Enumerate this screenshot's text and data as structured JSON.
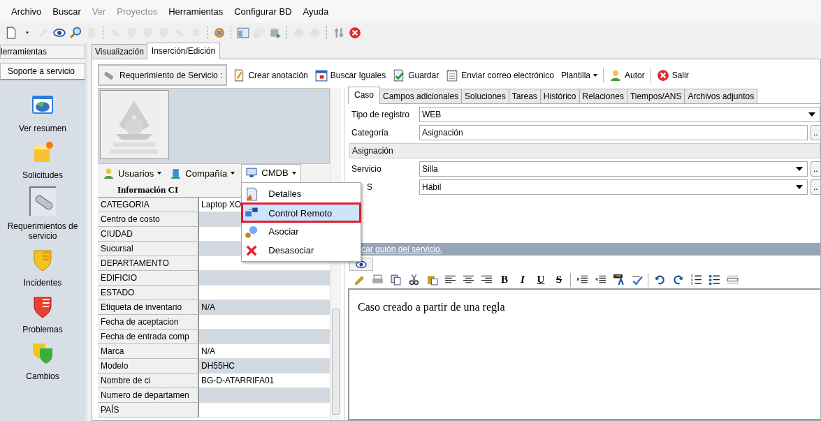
{
  "menu_bar": [
    {
      "label": "Archivo",
      "disabled": false
    },
    {
      "label": "Buscar",
      "disabled": false
    },
    {
      "label": "Ver",
      "disabled": true
    },
    {
      "label": "Proyectos",
      "disabled": true
    },
    {
      "label": "Herramientas",
      "disabled": false
    },
    {
      "label": "Configurar BD",
      "disabled": false
    },
    {
      "label": "Ayuda",
      "disabled": false
    }
  ],
  "toolbar": [
    {
      "disabled": false
    },
    {
      "disabled": false
    },
    {
      "disabled": true
    },
    {
      "disabled": false
    },
    {
      "disabled": false
    },
    {
      "disabled": true
    },
    {
      "disabled": true
    },
    {
      "disabled": true
    },
    {
      "disabled": true
    },
    {
      "disabled": true
    },
    {
      "disabled": true
    },
    {
      "disabled": true
    },
    {
      "disabled": false
    },
    {
      "disabled": false
    },
    {
      "disabled": true
    },
    {
      "disabled": false
    },
    {
      "disabled": true
    },
    {
      "disabled": true
    },
    {
      "disabled": false
    },
    {
      "disabled": false
    }
  ],
  "sidebar": {
    "tab": "lerramientas",
    "header": "Soporte a servicio",
    "items": [
      {
        "label": "Ver resumen",
        "selected": false
      },
      {
        "label": "Solicitudes",
        "selected": false
      },
      {
        "label": "Requerimientos de servicio",
        "selected": true
      },
      {
        "label": "Incidentes",
        "selected": false
      },
      {
        "label": "Problemas",
        "selected": false
      },
      {
        "label": "Cambios",
        "selected": false
      }
    ]
  },
  "main_tabs": [
    {
      "label": "Visualización",
      "selected": false
    },
    {
      "label": "Inserción/Edición",
      "selected": true
    }
  ],
  "action_bar": {
    "title": "Requerimiento de Servicio :",
    "buttons": [
      {
        "label": "Crear anotación",
        "dropdown": false
      },
      {
        "label": "Buscar Iguales",
        "dropdown": false
      },
      {
        "label": "Guardar",
        "dropdown": false
      },
      {
        "label": "Enviar correo electrónico",
        "dropdown": false
      },
      {
        "label": "Plantilla",
        "dropdown": true
      },
      {
        "label": "Autor",
        "dropdown": false
      },
      {
        "label": "Salir",
        "dropdown": false
      }
    ]
  },
  "ci_toolbar": [
    {
      "label": "Usuarios",
      "open": false
    },
    {
      "label": "Compañía",
      "open": false
    },
    {
      "label": "CMDB",
      "open": true
    }
  ],
  "cmdb_menu": [
    {
      "label": "Detalles",
      "selected": false
    },
    {
      "label": "Control Remoto",
      "selected": true
    },
    {
      "label": "Asociar",
      "selected": false
    },
    {
      "label": "Desasociar",
      "selected": false
    }
  ],
  "ci_table": {
    "title": "Información CI",
    "rows": [
      {
        "label": "CATEGORIA",
        "value": "Laptop XO"
      },
      {
        "label": "Centro de costo"
      },
      {
        "label": "CIUDAD"
      },
      {
        "label": "Sucursal"
      },
      {
        "label": "DEPARTAMENTO"
      },
      {
        "label": "EDIFICIO"
      },
      {
        "label": "ESTADO"
      },
      {
        "label": "Etiqueta de inventario",
        "value": "N/A"
      },
      {
        "label": "Fecha de aceptacion"
      },
      {
        "label": "Fecha de entrada comp"
      },
      {
        "label": "Marca",
        "value": "N/A"
      },
      {
        "label": "Modelo",
        "value": "DH55HC"
      },
      {
        "label": "Nombre de ci",
        "value": "BG-D-ATARRIFA01"
      },
      {
        "label": "Numero de departamen"
      },
      {
        "label": "PAÍS"
      }
    ]
  },
  "detail_tabs": [
    {
      "label": "Caso",
      "selected": true
    },
    {
      "label": "Campos adicionales",
      "selected": false
    },
    {
      "label": "Soluciones",
      "selected": false
    },
    {
      "label": "Tareas",
      "selected": false
    },
    {
      "label": "Histórico",
      "selected": false
    },
    {
      "label": "Relaciones",
      "selected": false
    },
    {
      "label": "Tiempos/ANS",
      "selected": false
    },
    {
      "label": "Archivos adjuntos",
      "selected": false
    }
  ],
  "form": [
    {
      "kind": "dropdown",
      "label": "Tipo de registro",
      "value": "WEB"
    },
    {
      "kind": "picker",
      "label": "Categoría",
      "value": "Asignación",
      "button": ".."
    },
    {
      "kind": "section",
      "value": "Asignación"
    },
    {
      "kind": "dropdown-picker",
      "label": "Servicio",
      "value": "Silla",
      "button": ".."
    },
    {
      "kind": "dropdown-picker",
      "label": "S",
      "value": "Hábil",
      "button": "..",
      "partly_hidden": true
    }
  ],
  "script_link": "car guión del servicio.",
  "editor": {
    "format_buttons": [
      "B",
      "I",
      "U",
      "S"
    ],
    "content": "Caso creado a partir de una regla"
  }
}
